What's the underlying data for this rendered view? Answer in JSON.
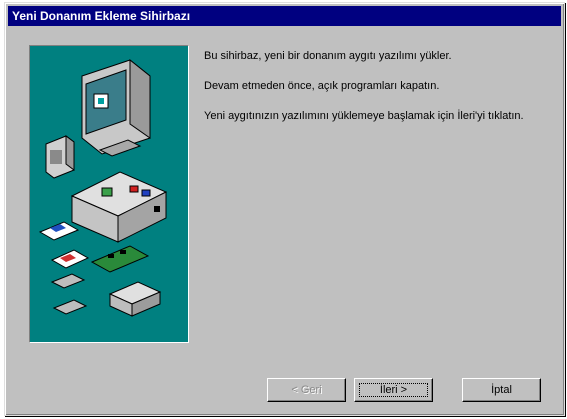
{
  "window": {
    "title": "Yeni Donanım Ekleme Sihirbazı"
  },
  "content": {
    "paragraphs": [
      "Bu sihirbaz, yeni bir donanım aygıtı yazılımı yükler.",
      "Devam etmeden önce, açık programları kapatın.",
      "Yeni aygıtınızın yazılımını yüklemeye başlamak için İleri'yi tıklatın."
    ]
  },
  "buttons": {
    "back": {
      "label": "< Geri",
      "enabled": false
    },
    "next": {
      "label": "İleri >",
      "focused": true
    },
    "cancel": {
      "label": "İptal"
    }
  },
  "colors": {
    "titlebar": "#000080",
    "face": "#c0c0c0",
    "art_background": "#008080"
  },
  "icons": [
    "monitor-icon",
    "speaker-icon",
    "computer-case-icon",
    "floppy-disk-icon",
    "expansion-card-icon",
    "external-drive-icon"
  ]
}
